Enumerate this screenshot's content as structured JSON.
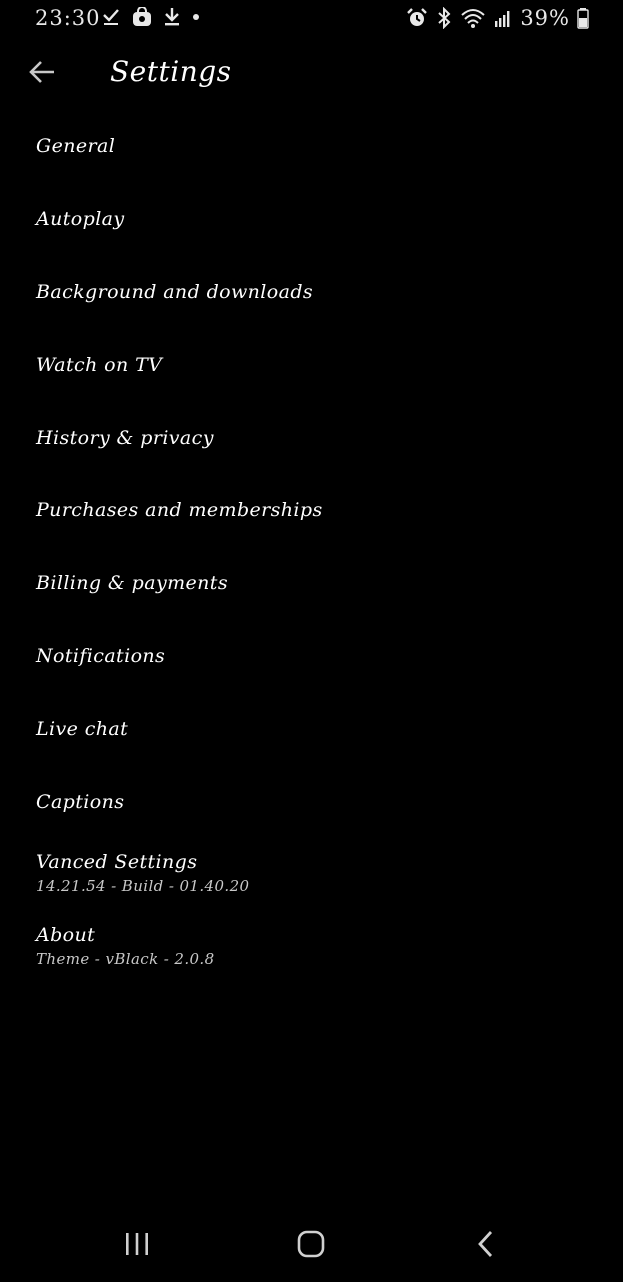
{
  "status_bar": {
    "time": "23:30",
    "battery": "39%",
    "left_icons": [
      "check-icon",
      "bag-icon",
      "download-icon",
      "dot-icon"
    ],
    "right_icons": [
      "alarm-icon",
      "bluetooth-icon",
      "wifi-icon",
      "signal-icon",
      "battery-icon"
    ]
  },
  "app_bar": {
    "title": "Settings",
    "back_icon": "back-arrow-icon"
  },
  "settings": {
    "items": [
      {
        "label": "General"
      },
      {
        "label": "Autoplay"
      },
      {
        "label": "Background and downloads"
      },
      {
        "label": "Watch on TV"
      },
      {
        "label": "History & privacy"
      },
      {
        "label": "Purchases and memberships"
      },
      {
        "label": "Billing & payments"
      },
      {
        "label": "Notifications"
      },
      {
        "label": "Live chat"
      },
      {
        "label": "Captions"
      },
      {
        "label": "Vanced Settings",
        "sublabel": "14.21.54 - Build - 01.40.20"
      },
      {
        "label": "About",
        "sublabel": "Theme - vBlack - 2.0.8"
      }
    ]
  },
  "nav_bar": {
    "icons": [
      "recent-apps-icon",
      "home-icon",
      "back-icon"
    ]
  },
  "colors": {
    "background": "#000000",
    "text": "#ffffff",
    "secondary_text": "#c8c8c8"
  }
}
